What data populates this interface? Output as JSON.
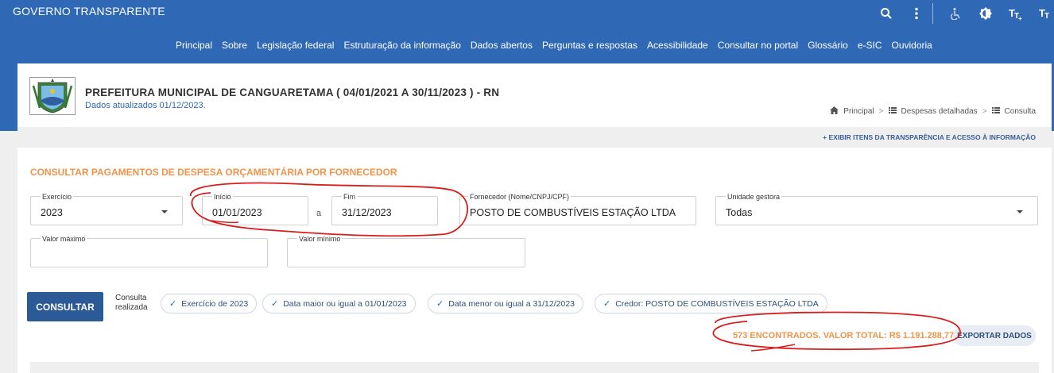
{
  "brand": "GOVERNO TRANSPARENTE",
  "top_icons": [
    "search-icon",
    "more-vert-icon",
    "accessibility-icon",
    "contrast-icon",
    "font-increase-icon",
    "font-decrease-icon"
  ],
  "nav": [
    "Principal",
    "Sobre",
    "Legislação federal",
    "Estruturação da informação",
    "Dados abertos",
    "Perguntas e respostas",
    "Acessibilidade",
    "Consultar no portal",
    "Glossário",
    "e-SIC",
    "Ouvidoria"
  ],
  "header": {
    "title": "PREFEITURA MUNICIPAL DE CANGUARETAMA ( 04/01/2021 A 30/11/2023 ) - RN",
    "updated": "Dados atualizados 01/12/2023."
  },
  "breadcrumb": [
    "Principal",
    "Despesas detalhadas",
    "Consulta"
  ],
  "exibir": "+ EXIBIR ITENS DA TRANSPARÊNCIA E ACESSO À INFORMAÇÃO",
  "section_title": "CONSULTAR PAGAMENTOS DE DESPESA ORÇAMENTÁRIA POR FORNECEDOR",
  "form": {
    "exercicio": {
      "label": "Exercício",
      "value": "2023"
    },
    "inicio": {
      "label": "Início",
      "value": "01/01/2023"
    },
    "a": "a",
    "fim": {
      "label": "Fim",
      "value": "31/12/2023"
    },
    "fornecedor": {
      "label": "Fornecedor (Nome/CNPJ/CPF)",
      "value": "POSTO DE COMBUSTÍVEIS ESTAÇÃO LTDA"
    },
    "unidade": {
      "label": "Unidade gestora",
      "value": "Todas"
    },
    "valor_maximo": {
      "label": "Valor máximo",
      "value": ""
    },
    "valor_minimo": {
      "label": "Valor mínimo",
      "value": ""
    }
  },
  "consultar_label": "CONSULTAR",
  "consulta_realizada": "Consulta realizada",
  "chips": [
    "Exercício de 2023",
    "Data maior ou igual a 01/01/2023",
    "Data menor ou igual a 31/12/2023",
    "Credor: POSTO DE COMBUSTÍVEIS ESTAÇÃO LTDA"
  ],
  "total": "573 ENCONTRADOS. VALOR TOTAL: R$ 1.191.288,77",
  "export_label": "EXPORTAR DADOS",
  "colors": {
    "primary": "#2f68b5",
    "accent": "#f0944a",
    "annotation": "#d81e1e"
  }
}
